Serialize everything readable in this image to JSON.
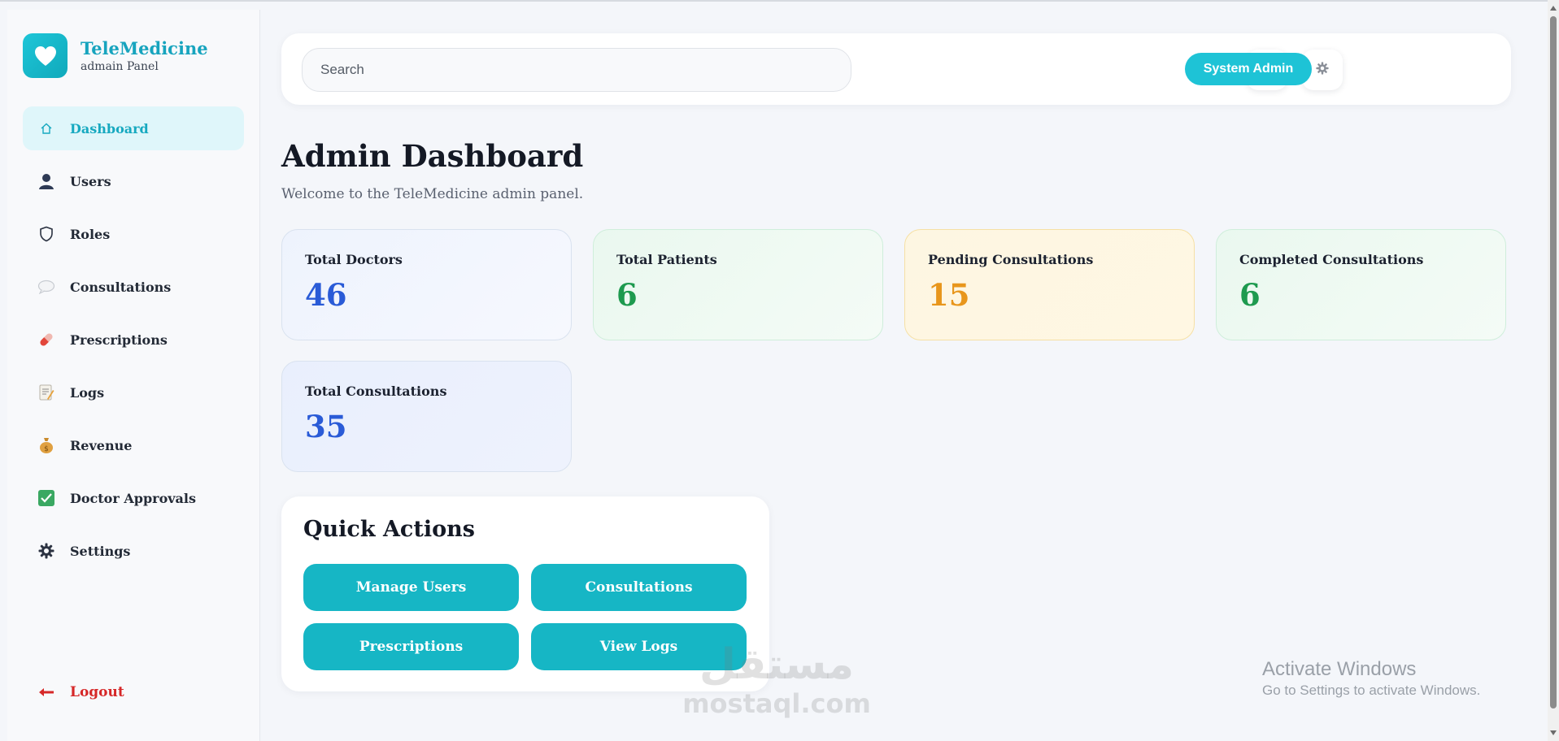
{
  "brand": {
    "name": "TeleMedicine",
    "subtitle": "admain Panel"
  },
  "sidebar": {
    "items": [
      {
        "label": "Dashboard",
        "icon": "home-icon",
        "active": true
      },
      {
        "label": "Users",
        "icon": "user-icon"
      },
      {
        "label": "Roles",
        "icon": "shield-icon"
      },
      {
        "label": "Consultations",
        "icon": "speech-bubble-icon"
      },
      {
        "label": "Prescriptions",
        "icon": "pill-icon"
      },
      {
        "label": "Logs",
        "icon": "memo-icon"
      },
      {
        "label": "Revenue",
        "icon": "money-bag-icon"
      },
      {
        "label": "Doctor Approvals",
        "icon": "check-box-icon"
      },
      {
        "label": "Settings",
        "icon": "gear-icon"
      }
    ],
    "logout": {
      "label": "Logout",
      "icon": "arrow-left-icon"
    }
  },
  "header": {
    "search_placeholder": "Search",
    "notifications_icon": "bell-icon",
    "settings_icon": "gear-icon",
    "user_button": "System Admin"
  },
  "page": {
    "title": "Admin Dashboard",
    "subtitle": "Welcome to the TeleMedicine admin panel."
  },
  "stats": [
    {
      "label": "Total Doctors",
      "value": "46",
      "color": "#2a5bd7"
    },
    {
      "label": "Total Patients",
      "value": "6",
      "color": "#1e9a4f"
    },
    {
      "label": "Pending Consultations",
      "value": "15",
      "color": "#e8961c"
    },
    {
      "label": "Completed Consultations",
      "value": "6",
      "color": "#1e9a4f"
    },
    {
      "label": "Total Consultations",
      "value": "35",
      "color": "#2a5bd7"
    }
  ],
  "quick_actions": {
    "title": "Quick Actions",
    "buttons": [
      "Manage Users",
      "Consultations",
      "Prescriptions",
      "View Logs"
    ]
  },
  "watermark": {
    "arabic": "مستقل",
    "latin": "mostaql.com"
  },
  "os_overlay": {
    "line1": "Activate Windows",
    "line2": "Go to Settings to activate Windows."
  },
  "colors": {
    "accent": "#1ec3d6",
    "active_bg": "#dff6fa",
    "logout": "#d62828"
  }
}
